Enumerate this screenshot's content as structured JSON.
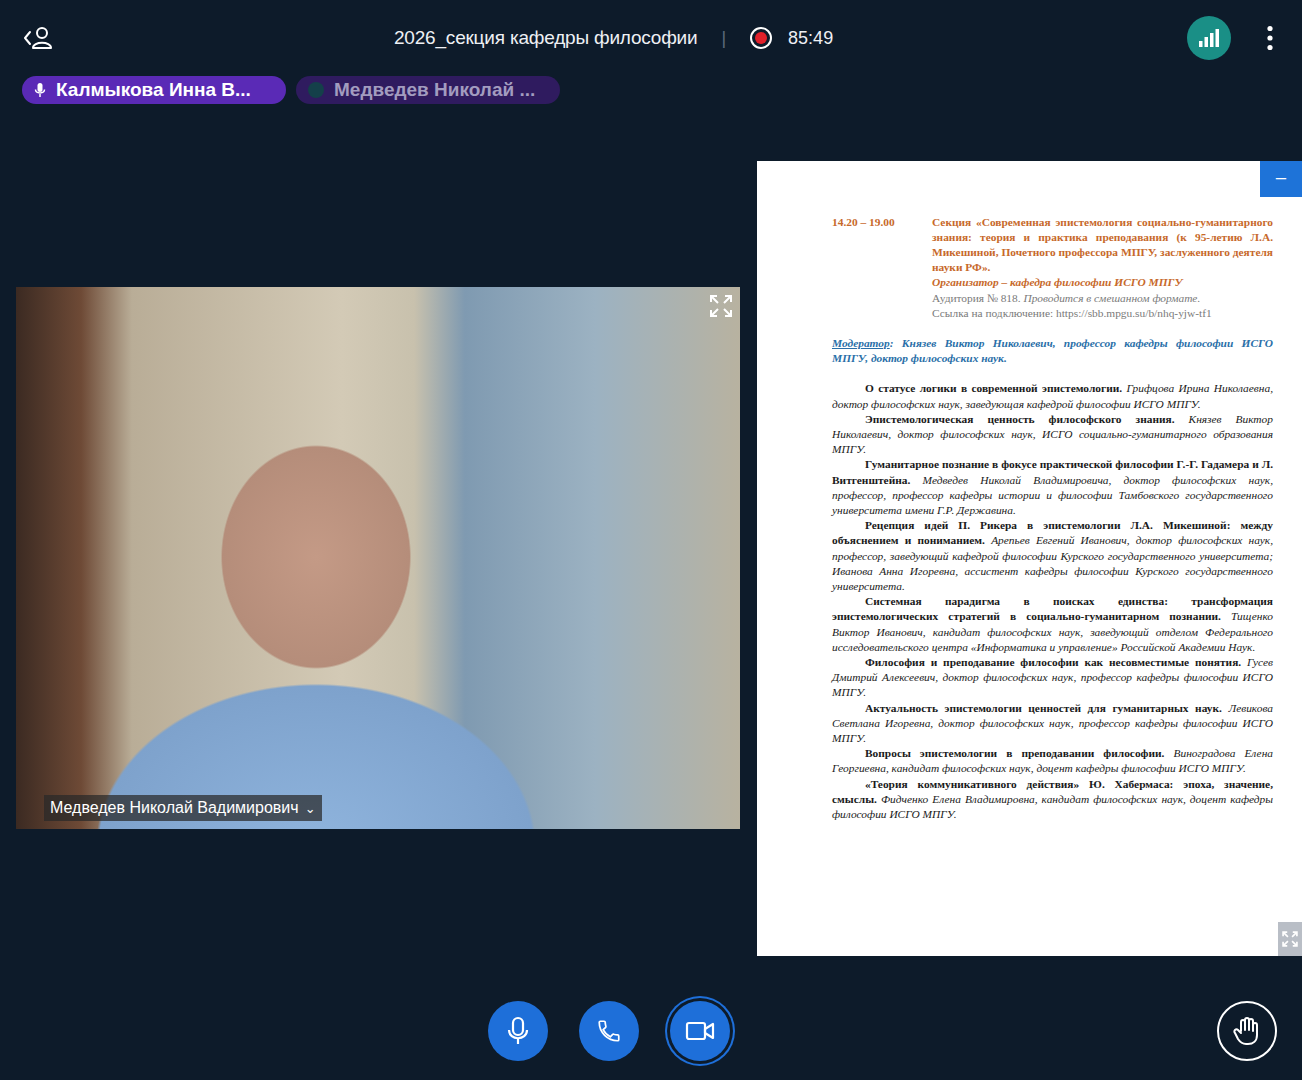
{
  "topbar": {
    "title": "2026_секция кафедры философии",
    "separator": "|",
    "recording": true,
    "timer": "85:49"
  },
  "participants": [
    {
      "name": "Калмыкова Инна В...",
      "speaking": true
    },
    {
      "name": "Медведев Николай ...",
      "speaking": false
    }
  ],
  "video": {
    "name_label": "Медведев Николай Вадимирович",
    "caret": "⌄"
  },
  "document": {
    "minimize": "−",
    "time": "14.20 – 19.00",
    "section": "Секция «Современная эпистемология социально-гуманитарного знания: теория и практика преподавания (к 95-летию Л.А. Микешиной, Почетного профессора МПГУ, заслуженного деятеля науки РФ».",
    "organizer": "Организатор – кафедра философии ИСГО МПГУ",
    "room": "Аудитория № 818.",
    "format": "Проводится в смешанном формате.",
    "link": "Ссылка на подключение: https://sbb.mpgu.su/b/nhq-yjw-tf1",
    "moderator_label": "Модератор",
    "moderator": ": Князев Виктор Николаевич, профессор кафедры философии ИСГО МПГУ, доктор философских наук.",
    "talks": [
      {
        "title": "О статусе логики в современной эпистемологии.",
        "author": "Грифцова Ирина Николаевна, доктор философских наук, заведующая кафедрой философии ИСГО МПГУ."
      },
      {
        "title": "Эпистемологическая ценность философского знания.",
        "author": "Князев Виктор Николаевич, доктор философских наук, ИСГО социально-гуманитарного образования МПГУ."
      },
      {
        "title": "Гуманитарное познание в фокусе практической философии Г.-Г. Гадамера и Л. Витгенштейна.",
        "author": "Медведев Николай Владимировича, доктор философских наук, профессор, профессор кафедры истории и философии Тамбовского государственного университета имени Г.Р. Державина."
      },
      {
        "title": "Рецепция идей П. Рикера в эпистемологии Л.А. Микешиной: между объяснением и пониманием.",
        "author": "Арепьев Евгений Иванович, доктор философских наук, профессор, заведующий кафедрой философии Курского государственного университета; Иванова Анна Игоревна, ассистент кафедры философии Курского государственного университета."
      },
      {
        "title": "Системная парадигма в поисках единства: трансформация эпистемологических стратегий в социально-гуманитарном познании.",
        "author": "Тищенко Виктор Иванович, кандидат философских наук, заведующий отделом Федерального исследовательского центра «Информатика и управление» Российской Академии Наук."
      },
      {
        "title": "Философия и преподавание философии как несовместимые понятия.",
        "author": "Гусев Дмитрий Алексеевич, доктор философских наук, профессор кафедры философии ИСГО МПГУ."
      },
      {
        "title": "Актуальность эпистемологии ценностей для гуманитарных наук.",
        "author": "Левикова Светлана Игоревна, доктор философских наук, профессор кафедры философии ИСГО МПГУ."
      },
      {
        "title": "Вопросы эпистемологии в преподавании философии.",
        "author": "Виноградова Елена Георгиевна, кандидат философских наук, доцент кафедры философии ИСГО МПГУ."
      },
      {
        "title": "«Теория коммуникативного действия» Ю. Хабермаса: эпоха, значение, смыслы.",
        "author": "Фидченко Елена Владимировна, кандидат философских наук, доцент кафедры философии ИСГО МПГУ."
      }
    ]
  },
  "controls": [
    {
      "kind": "mic",
      "selected": false
    },
    {
      "kind": "phone",
      "selected": false
    },
    {
      "kind": "camera",
      "selected": true
    }
  ],
  "raise_hand": {
    "raised": false
  }
}
